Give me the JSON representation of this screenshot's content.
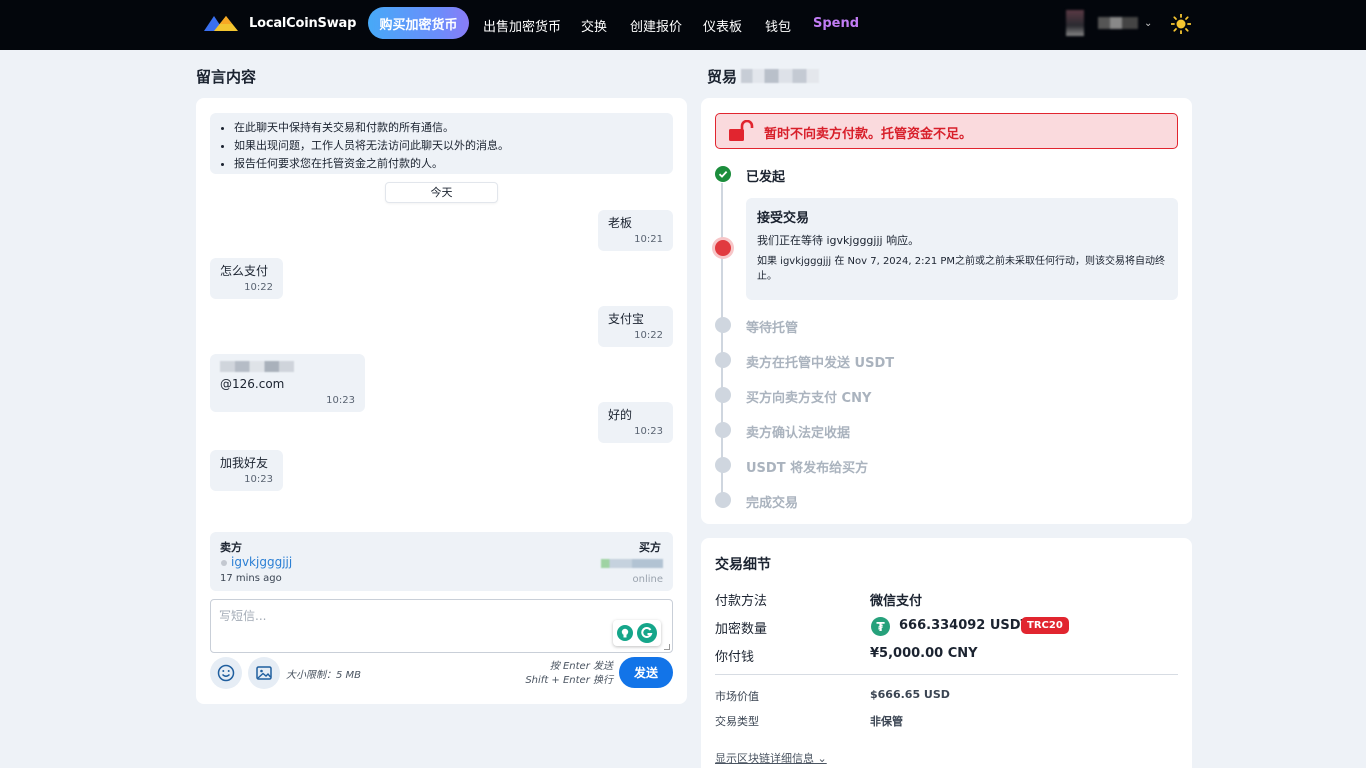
{
  "nav": {
    "brand": "LocalCoinSwap",
    "buy": "购买加密货币",
    "sell": "出售加密货币",
    "exchange": "交换",
    "create_offer": "创建报价",
    "dashboard": "仪表板",
    "wallet": "钱包",
    "spend": "Spend"
  },
  "chat": {
    "title": "留言内容",
    "rules": [
      "在此聊天中保持有关交易和付款的所有通信。",
      "如果出现问题，工作人员将无法访问此聊天以外的消息。",
      "报告任何要求您在托管资金之前付款的人。"
    ],
    "day_separator": "今天",
    "messages": [
      {
        "side": "right",
        "text": "老板",
        "time": "10:21"
      },
      {
        "side": "left",
        "text": "怎么支付",
        "time": "10:22"
      },
      {
        "side": "right",
        "text": "支付宝",
        "time": "10:22"
      },
      {
        "side": "left",
        "text": "@126.com",
        "time": "10:23"
      },
      {
        "side": "right",
        "text": "好的",
        "time": "10:23"
      },
      {
        "side": "left",
        "text": "加我好友",
        "time": "10:23"
      }
    ],
    "seller_label": "卖方",
    "buyer_label": "买方",
    "seller_name": "igvkjgggjjj",
    "seller_last_seen": "17 mins ago",
    "buyer_status": "online",
    "input_placeholder": "写短信...",
    "size_limit": "大小限制：5 MB",
    "enter_hint": "按 Enter 发送",
    "shift_hint": "Shift + Enter 换行",
    "send": "发送"
  },
  "trade": {
    "title": "贸易",
    "alert": "暂时不向卖方付款。托管资金不足。",
    "steps": [
      {
        "label": "已发起",
        "state": "done"
      },
      {
        "label": "接受交易",
        "state": "active"
      },
      {
        "label": "等待托管",
        "state": "pending"
      },
      {
        "label": "卖方在托管中发送 USDT",
        "state": "pending"
      },
      {
        "label": "买方向卖方支付 CNY",
        "state": "pending"
      },
      {
        "label": "卖方确认法定收据",
        "state": "pending"
      },
      {
        "label": "USDT 将发布给买方",
        "state": "pending"
      },
      {
        "label": "完成交易",
        "state": "pending"
      }
    ],
    "accept_waiting": "我们正在等待 igvkjgggjjj 响应。",
    "accept_note": "如果 igvkjgggjjj 在 Nov 7, 2024, 2:21 PM之前或之前未采取任何行动，则该交易将自动终止。"
  },
  "details": {
    "title": "交易细节",
    "payment_method_label": "付款方法",
    "payment_method": "微信支付",
    "crypto_amount_label": "加密数量",
    "crypto_amount": "666.334092 USDT",
    "network_badge": "TRC20",
    "you_pay_label": "你付钱",
    "you_pay": "¥5,000.00 CNY",
    "market_value_label": "市场价值",
    "market_value": "$666.65 USD",
    "trade_type_label": "交易类型",
    "trade_type": "非保管",
    "show_chain": "显示区块链详细信息"
  },
  "colors": {
    "accent_blue": "#1274e8",
    "alert_red": "#e1252f",
    "success_green": "#1b8d3c",
    "tether_green": "#26a17b",
    "spend_purple": "#c17cf4"
  }
}
